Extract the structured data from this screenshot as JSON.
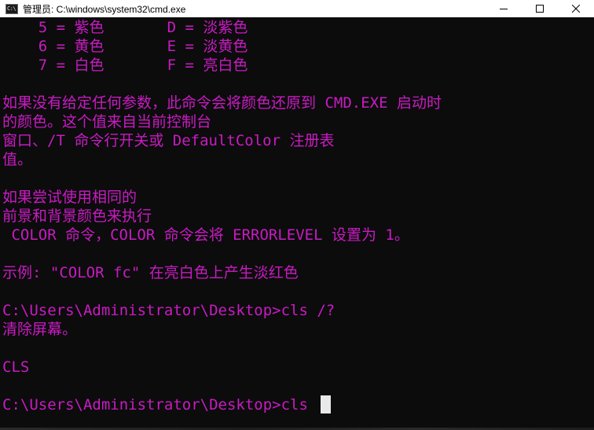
{
  "window": {
    "title": "管理员: C:\\windows\\system32\\cmd.exe",
    "icon_text": "C:\\",
    "controls": {
      "minimize_icon": "minimize-icon",
      "maximize_icon": "maximize-icon",
      "close_icon": "close-icon"
    }
  },
  "console": {
    "text_color": "#c91bc3",
    "background_color": "#0c0c0c",
    "lines": [
      "    5 = 紫色       D = 淡紫色",
      "    6 = 黄色       E = 淡黄色",
      "    7 = 白色       F = 亮白色",
      "",
      "如果没有给定任何参数，此命令会将颜色还原到 CMD.EXE 启动时",
      "的颜色。这个值来自当前控制台",
      "窗口、/T 命令行开关或 DefaultColor 注册表",
      "值。",
      "",
      "如果尝试使用相同的",
      "前景和背景颜色来执行",
      " COLOR 命令，COLOR 命令会将 ERRORLEVEL 设置为 1。",
      "",
      "示例: \"COLOR fc\" 在亮白色上产生淡红色",
      "",
      "C:\\Users\\Administrator\\Desktop>cls /?",
      "清除屏幕。",
      "",
      "CLS",
      "",
      "C:\\Users\\Administrator\\Desktop>cls"
    ]
  }
}
